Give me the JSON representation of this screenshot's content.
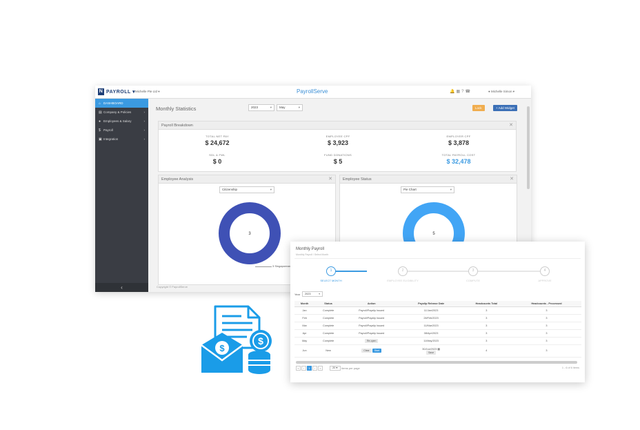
{
  "topbar": {
    "logo": "PAYROLL",
    "company": "Michelle Pte Ltd",
    "brand": "PayrollServe",
    "user": "Michelle Simon"
  },
  "sidebar": {
    "items": [
      {
        "label": "DASHBOARD",
        "active": true
      },
      {
        "label": "Company & Policies"
      },
      {
        "label": "Employees & Salary"
      },
      {
        "label": "Payroll"
      },
      {
        "label": "Integration"
      }
    ]
  },
  "dashboard": {
    "title": "Monthly Statistics",
    "year": "2023",
    "month": "May",
    "lock_label": "Lock",
    "add_widget_label": "+ Add Widget",
    "breakdown": {
      "title": "Payroll Breakdown",
      "stats": [
        {
          "label": "TOTAL NET PAY",
          "value": "$ 24,672"
        },
        {
          "label": "EMPLOYEE CPF",
          "value": "$ 3,923"
        },
        {
          "label": "EMPLOYER CPF",
          "value": "$ 3,878"
        },
        {
          "label": "SDL & FWL",
          "value": "$ 0"
        },
        {
          "label": "FUND DONATIONS",
          "value": "$ 5"
        },
        {
          "label": "TOTAL PAYROLL COST",
          "value": "$ 32,478"
        }
      ]
    },
    "analysis": {
      "title": "Employee Analysis",
      "select": "Citizenship",
      "center": "3",
      "legend": "3 Singaporean"
    },
    "status": {
      "title": "Employee Status",
      "select": "Pie Chart",
      "center": "5"
    },
    "copyright": "Copyright © PayrollServe"
  },
  "payroll": {
    "title": "Monthly Payroll",
    "breadcrumb": "Monthly Payroll / Select Month",
    "steps": [
      "SELECT MONTH",
      "EMPLOYEE ELIGIBILITY",
      "COMPUTE",
      "APPROVE"
    ],
    "year_label": "Year",
    "year_value": "2023",
    "columns": [
      "Month",
      "Status",
      "Action",
      "Payslip Release Date",
      "Headcounts Total",
      "Headcounts - Processed"
    ],
    "rows": [
      {
        "month": "Jan",
        "status": "Complete",
        "action": "Payroll/Payslip Issued",
        "release": "11/Jan/2023",
        "total": "3",
        "processed": "3"
      },
      {
        "month": "Feb",
        "status": "Complete",
        "action": "Payroll/Payslip Issued",
        "release": "28/Feb/2023",
        "total": "3",
        "processed": "3"
      },
      {
        "month": "Mar",
        "status": "Complete",
        "action": "Payroll/Payslip Issued",
        "release": "11/Mar/2023",
        "total": "3",
        "processed": "3"
      },
      {
        "month": "Apr",
        "status": "Complete",
        "action": "Payroll/Payslip Issued",
        "release": "08/Apr/2023",
        "total": "3",
        "processed": "3"
      },
      {
        "month": "May",
        "status": "Complete",
        "action": "Re-open",
        "release": "11/May/2023",
        "total": "3",
        "processed": "3"
      },
      {
        "month": "Jun",
        "status": "New",
        "action": "Clear",
        "action2": "Start",
        "release": "30/Jun/2023",
        "release_btn": "Save",
        "total": "4",
        "processed": "3"
      }
    ],
    "page_size": "20",
    "page_size_label": "items per page",
    "page_current": "1",
    "range_label": "1 - 6 of 6 items"
  }
}
